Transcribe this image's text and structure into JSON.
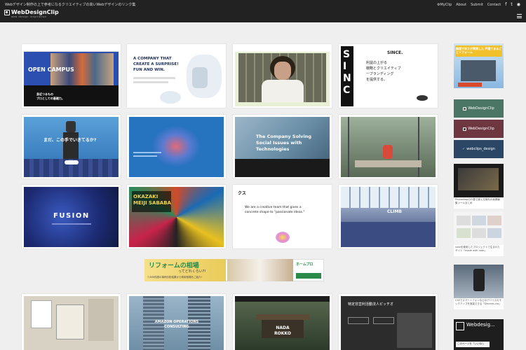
{
  "header": {
    "tagline": "Webデザイン制作の上で参考になるクリエイティブの高いWebデザインのリンク集",
    "logo_name": "WebDesignClip",
    "logo_sub": "web design inspiration",
    "nav": [
      "MyClip",
      "About",
      "Submit",
      "Contact"
    ],
    "icons": [
      "f",
      "t",
      "rss"
    ]
  },
  "cards": [
    {
      "title": "OPEN CAMPUS",
      "bg": "#2b4fb0"
    },
    {
      "title": "A COMPANY THAT CREATE A SURPRISE! FUN AND WIN.",
      "bg": "#ffffff"
    },
    {
      "title": "",
      "bg": "#e7efd4"
    },
    {
      "title": "SINCE.",
      "bg": "#ffffff"
    },
    {
      "title": "まだ、この手でいきてるか?",
      "bg": "#3a86c6"
    },
    {
      "title": "",
      "bg": "#2673bf"
    },
    {
      "title": "The Company Solving Social Issues with Technologies",
      "bg": "#6b90a8"
    },
    {
      "title": "",
      "bg": "#7a8a78"
    },
    {
      "title": "FUSION",
      "bg": "#1c2a72"
    },
    {
      "title": "OKAZAKI MEIJI SABABA",
      "bg": "#8a2a28"
    },
    {
      "title": "We are a creative team that gives a concrete shape to \"passionate ideas.\"",
      "bg": "#ffffff"
    },
    {
      "title": "CLIMB",
      "bg": "#2a3c70"
    },
    {
      "title": "",
      "bg": "#d8d2c4"
    },
    {
      "title": "AMAZON OPERATIONS CONSULTING",
      "bg": "#6f8fa6"
    },
    {
      "title": "NADA ROKKO",
      "bg": "#3c4a3a"
    },
    {
      "title": "特定非営利活動法人ピッチオ",
      "bg": "#2c2c2c"
    }
  ],
  "ad": {
    "headline": "リフォームの相場",
    "sub": "ってどれくらい?!",
    "small": "7,600件超の事例分析結果から費用相場をご紹介!",
    "brand": "ホームプロ"
  },
  "sidebar": {
    "top_ad": "無理で安さが実現した 戸建てまるごとリフォーム",
    "buttons": [
      {
        "label": "WebDesignClip",
        "color": "#4b7565"
      },
      {
        "label": "WebDesignClip",
        "color": "#6e3640"
      },
      {
        "label": "webclips_design",
        "color": "#2c4766"
      }
    ],
    "captions": [
      "Photoshopの代替で使える無料の画像編集ツールまとめ",
      "noteを使用したプロジェクトで生まれたサイト「made with note」",
      "CSSでスマートフォンなどのデバイスのモックアップを実装できる「Devices.css」"
    ],
    "fb_title": "Webdesig...",
    "fb_like": "このページを「いいね!」"
  }
}
